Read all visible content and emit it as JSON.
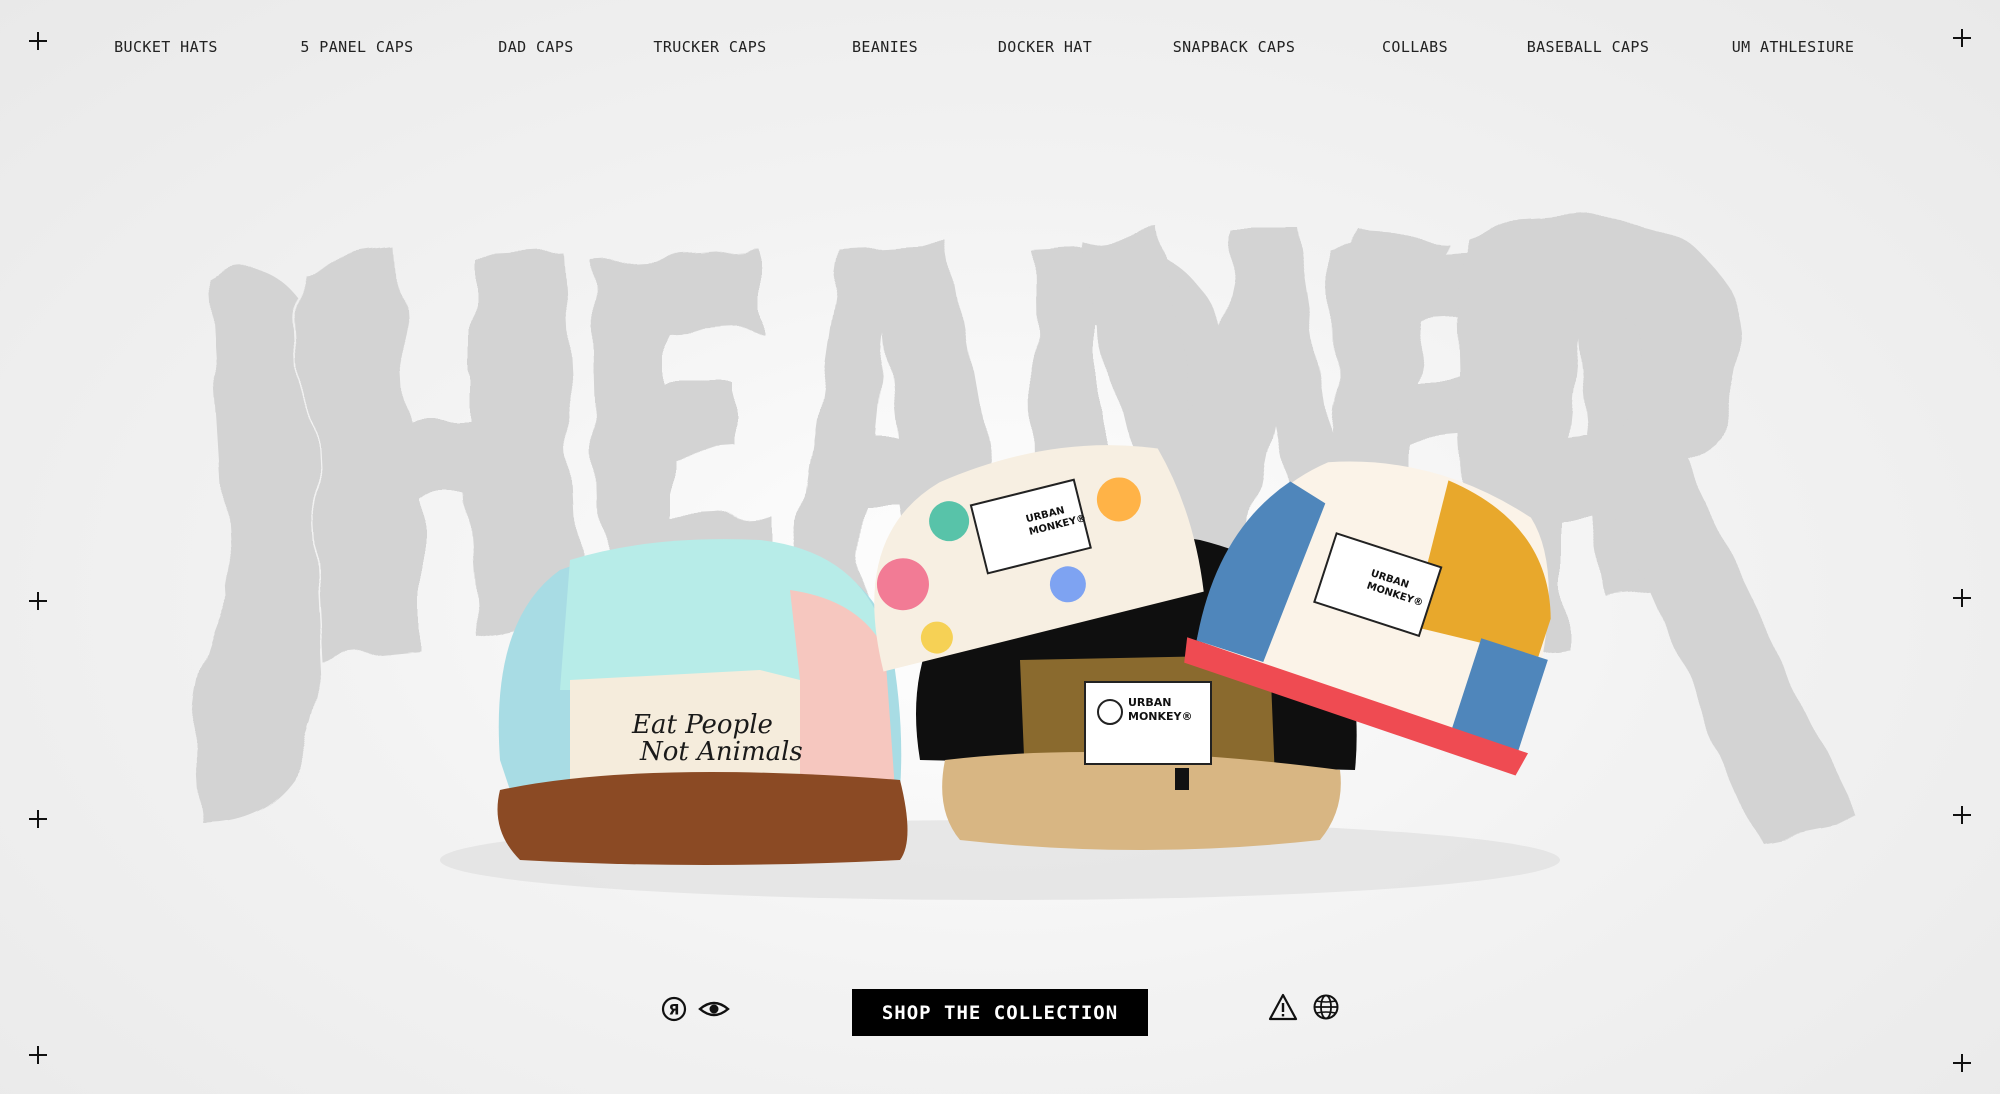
{
  "nav": {
    "items": [
      {
        "label": "BUCKET HATS"
      },
      {
        "label": "5 PANEL CAPS"
      },
      {
        "label": "DAD CAPS"
      },
      {
        "label": "TRUCKER CAPS"
      },
      {
        "label": "BEANIES"
      },
      {
        "label": "DOCKER HAT"
      },
      {
        "label": "SNAPBACK CAPS"
      },
      {
        "label": "COLLABS"
      },
      {
        "label": "BASEBALL CAPS"
      },
      {
        "label": "UM ATHLESIURE"
      }
    ]
  },
  "hero": {
    "caps": [
      {
        "embroidery": "Eat People Not Animals"
      },
      {
        "label_brand": "URBAN MONKEY®"
      },
      {
        "label_brand": "URBAN MONKEY®"
      },
      {
        "label_brand": "URBAN MONKEY®"
      }
    ]
  },
  "cta": {
    "label": "SHOP THE COLLECTION"
  },
  "icons": {
    "left": [
      "registered-r-icon",
      "eye-icon"
    ],
    "right": [
      "warning-triangle-icon",
      "globe-icon"
    ]
  },
  "colors": {
    "background": "#f2f2f2",
    "headwear_text": "#d3d3d3",
    "cta_bg": "#000000",
    "cta_text": "#ffffff"
  }
}
